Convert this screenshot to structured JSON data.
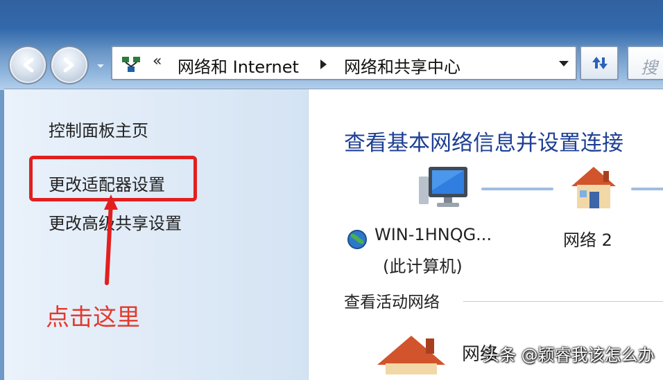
{
  "address_bar": {
    "overflow": "«",
    "crumbs": [
      "网络和 Internet",
      "网络和共享中心"
    ]
  },
  "search": {
    "placeholder": "搜"
  },
  "sidebar": {
    "home": "控制面板主页",
    "adapter": "更改适配器设置",
    "advanced_sharing": "更改高级共享设置"
  },
  "annotation": {
    "text": "点击这里",
    "color": "#e21f1f"
  },
  "main": {
    "heading": "查看基本网络信息并设置连接",
    "computer_name": "WIN-1HNQG...",
    "computer_sub": "(此计算机)",
    "network_name": "网络  2",
    "active_networks_label": "查看活动网络",
    "active_network_name": "网络"
  },
  "watermark": {
    "text": "头条 @颖睿我该怎么办"
  },
  "colors": {
    "heading": "#1e3f93",
    "highlight": "#e21f1f",
    "frame": "#2f67ab"
  }
}
